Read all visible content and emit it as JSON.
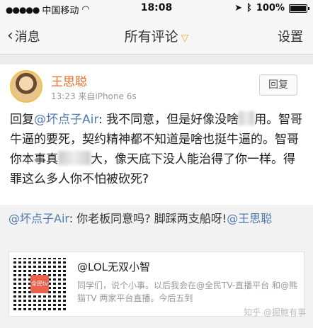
{
  "status": {
    "carrier": "中国移动",
    "time": "18:08",
    "battery": "100%"
  },
  "nav": {
    "back_label": "消息",
    "title": "所有评论",
    "settings_label": "设置"
  },
  "comment": {
    "username": "王思聪",
    "time": "13:23",
    "source": "来自iPhone 6s",
    "reply_label": "回复",
    "body_prefix": "回复",
    "mention": "@坏点子Air",
    "body_1": ": 我不同意，但是好像没啥",
    "body_2": "用。智哥牛逼的要死，契约精神都不知道是啥也挺牛逼的。智哥你本事真",
    "body_3": "大，像天底下没人能治得了你一样。得罪这么多人你不怕被砍死?"
  },
  "quote": {
    "mention": "@坏点子Air",
    "text": ": 你老板同意吗? 脚踩两支船呀!",
    "mention2": "@王思聪"
  },
  "card": {
    "title": "@LOL无双小智",
    "desc": "同学们，说个小事。以后我会在@全民TV-直播平台 和@熊猫TV 两家平台直播。今后五到",
    "qr_label": "全民tv"
  },
  "watermark": "知乎 @掘鲍有事"
}
